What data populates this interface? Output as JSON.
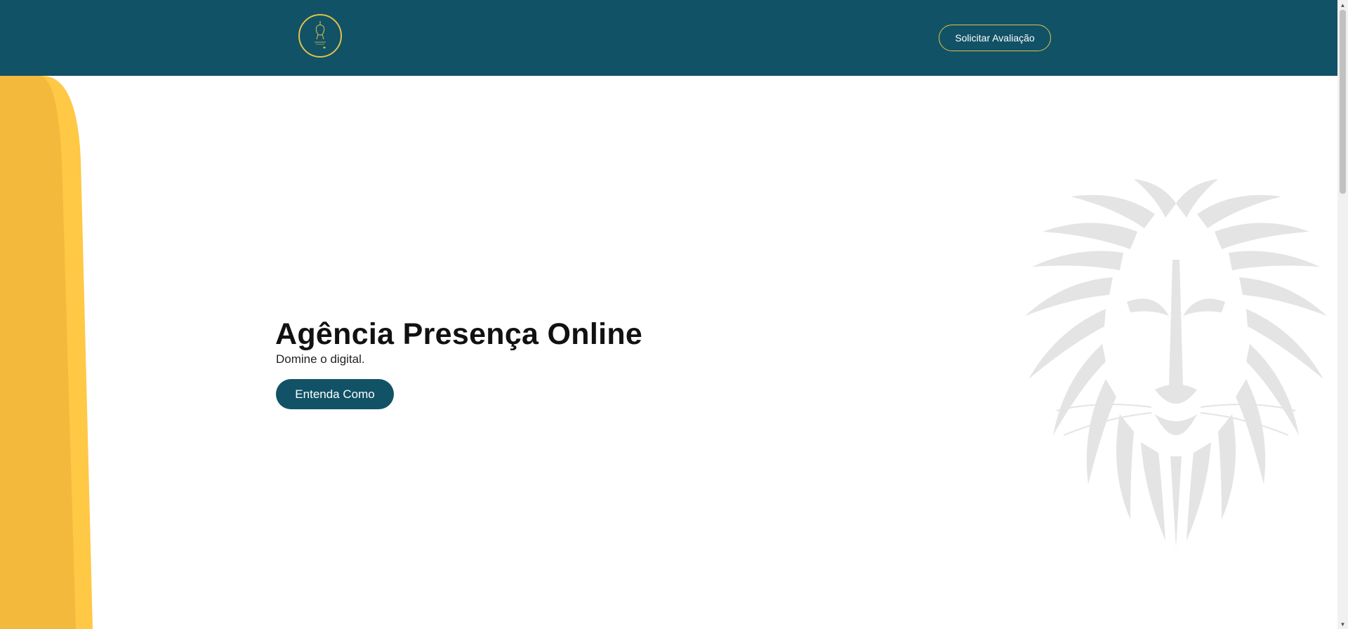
{
  "header": {
    "logo_icon": "lion-circle-logo-icon",
    "cta_label": "Solicitar Avaliação"
  },
  "hero": {
    "title": "Agência Presença Online",
    "subtitle": "Domine o digital.",
    "button_label": "Entenda Como",
    "background_icon": "lion-head-watermark-icon"
  },
  "colors": {
    "brand_teal": "#115266",
    "accent_gold": "#e2c14a",
    "wave_yellow_dark": "#f3b93c",
    "wave_yellow_light": "#ffc845",
    "watermark_gray": "#e4e4e4"
  },
  "scrollbar": {
    "up_icon": "scroll-up-arrow-icon",
    "down_icon": "scroll-down-arrow-icon"
  }
}
